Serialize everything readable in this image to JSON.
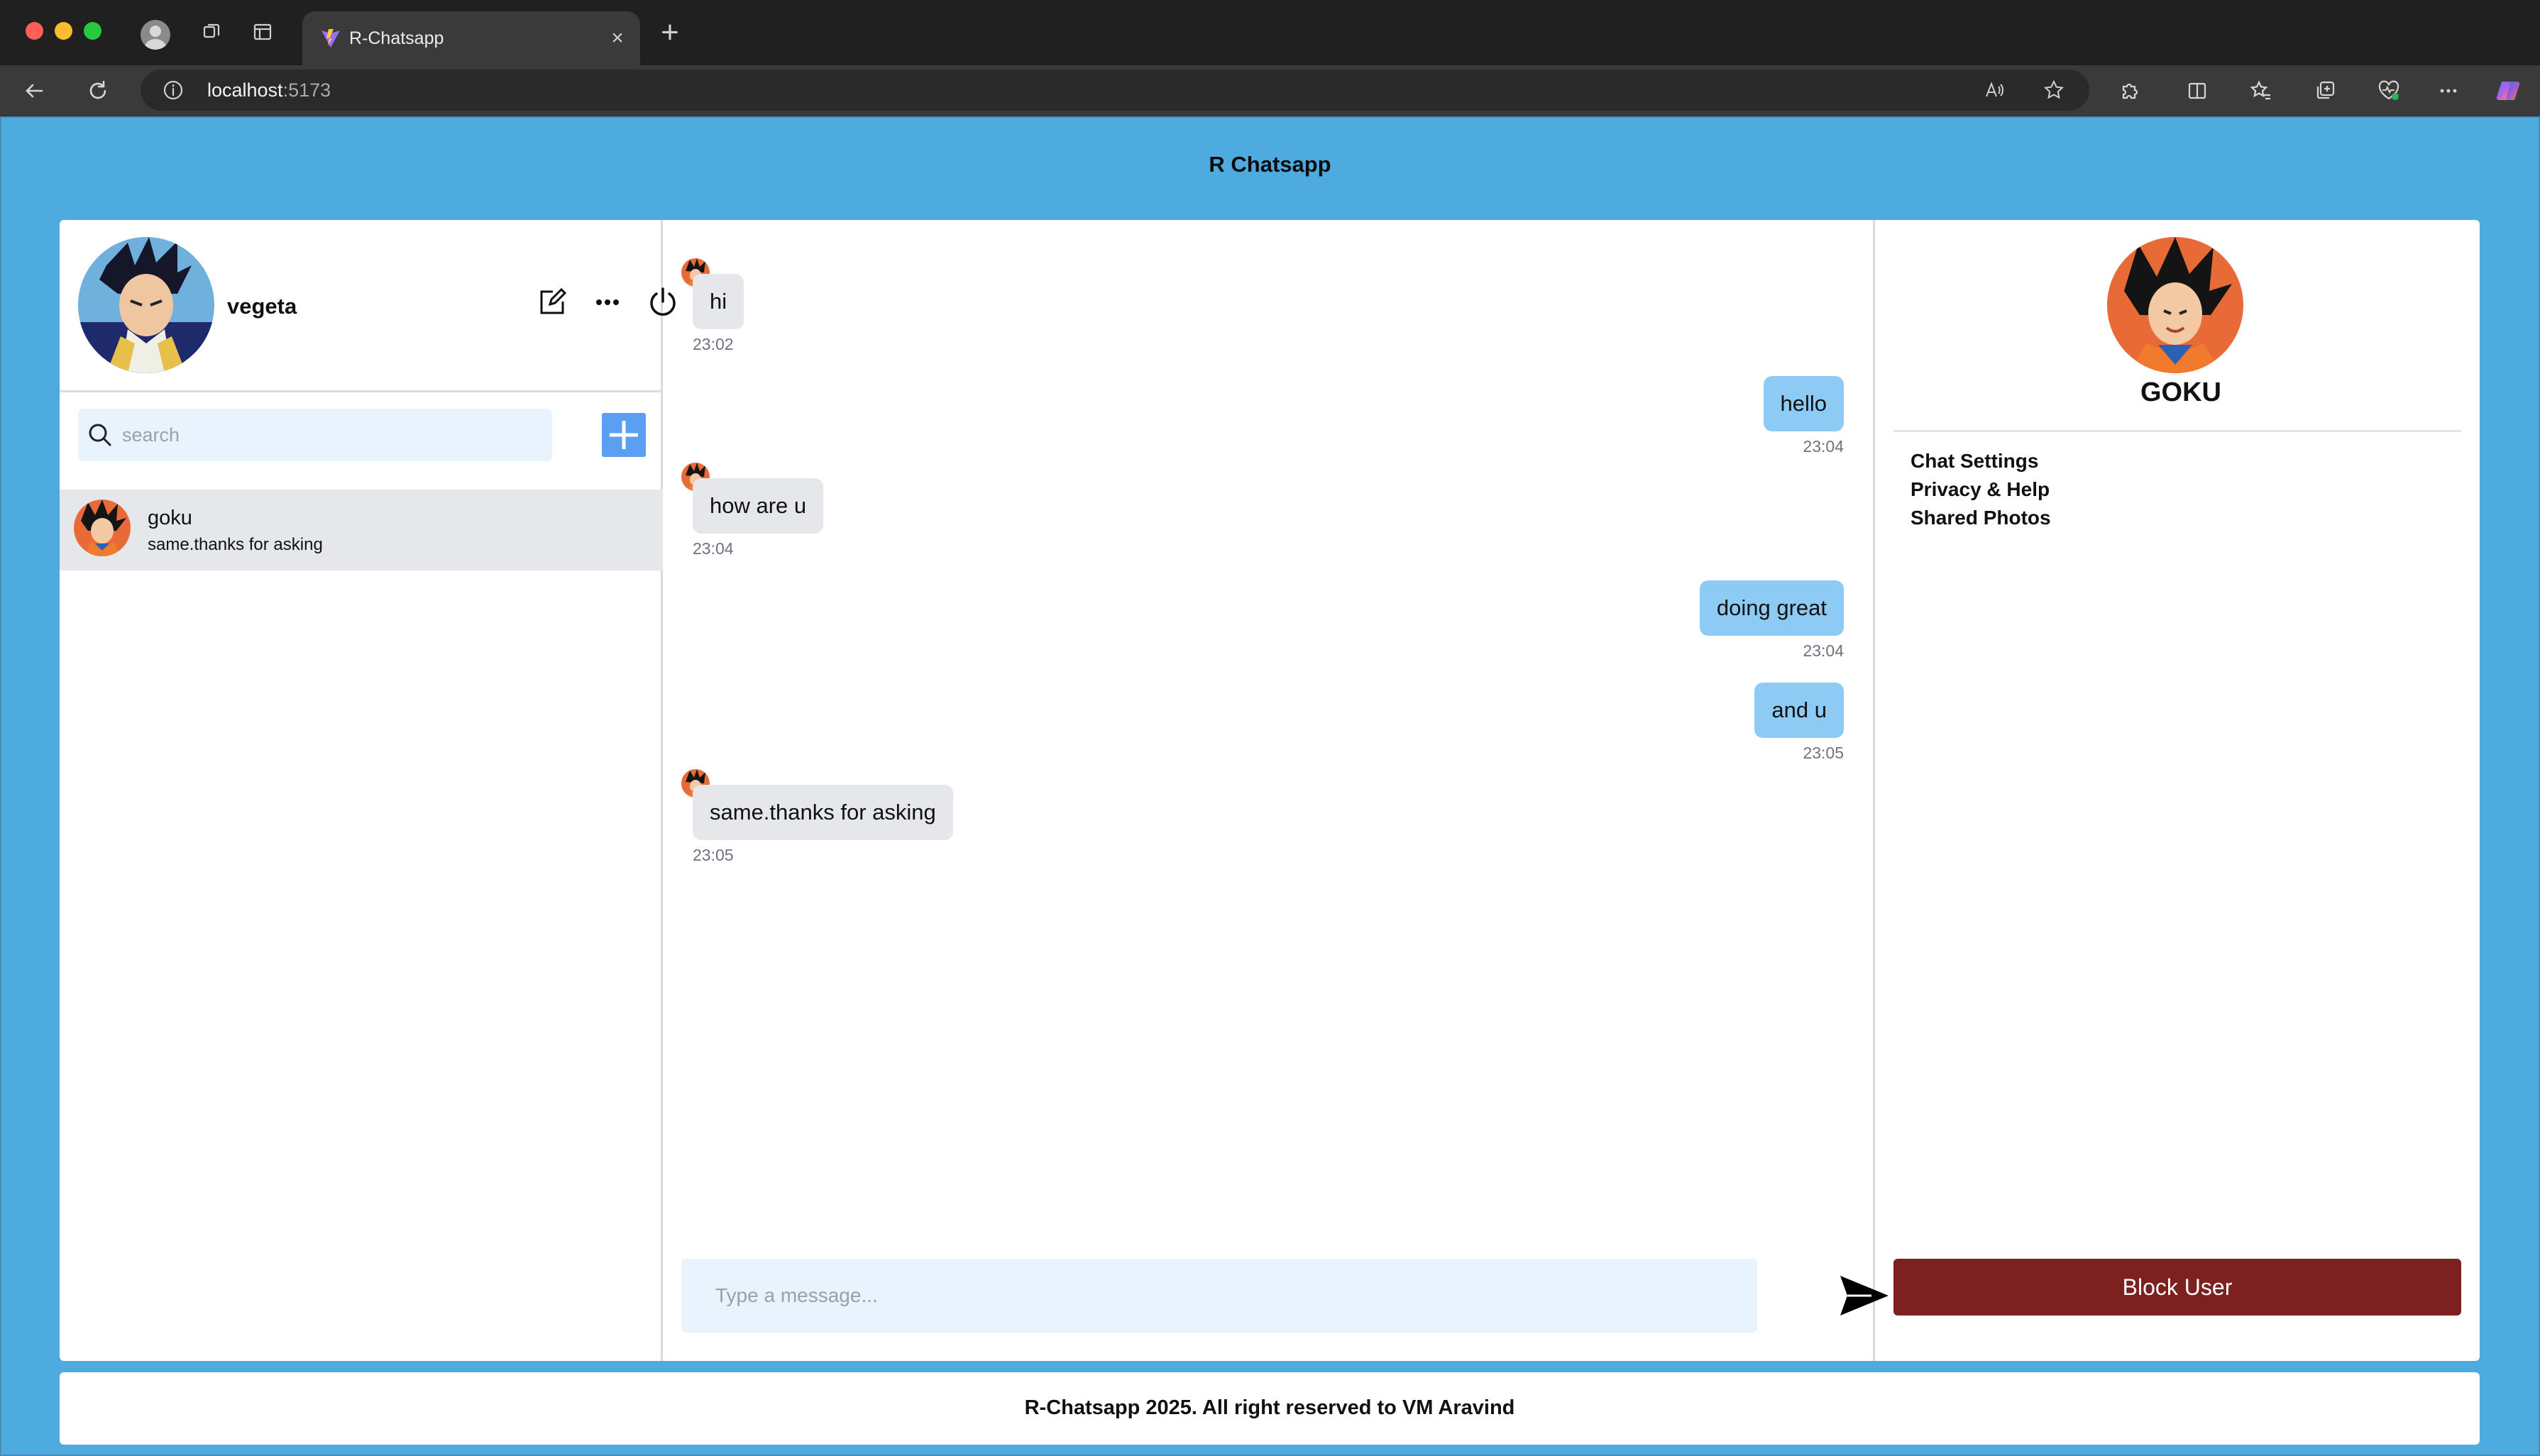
{
  "browser": {
    "tab_title": "R-Chatsapp",
    "tab_close_glyph": "×",
    "new_tab_glyph": "+",
    "url_host": "localhost",
    "url_port": ":5173",
    "icons": [
      "back-icon",
      "reload-icon",
      "info-icon",
      "read-aloud-icon",
      "favorite-icon",
      "extensions-icon",
      "split-screen-icon",
      "favorites-icon",
      "collections-icon",
      "health-icon",
      "more-icon",
      "copilot-icon"
    ]
  },
  "app": {
    "title": "R Chatsapp",
    "footer": "R-Chatsapp 2025. All right reserved to VM Aravind"
  },
  "current_user": {
    "name": "vegeta"
  },
  "search": {
    "placeholder": "search"
  },
  "conversations": [
    {
      "name": "goku",
      "preview": "same.thanks for asking",
      "selected": true
    }
  ],
  "chat": {
    "messages": [
      {
        "direction": "in",
        "text": "hi",
        "time": "23:02"
      },
      {
        "direction": "out",
        "text": "hello",
        "time": "23:04"
      },
      {
        "direction": "in",
        "text": "how are u",
        "time": "23:04"
      },
      {
        "direction": "out",
        "text": "doing great",
        "time": "23:04"
      },
      {
        "direction": "out",
        "text": "and u",
        "time": "23:05"
      },
      {
        "direction": "in",
        "text": "same.thanks for asking",
        "time": "23:05"
      }
    ],
    "composer_placeholder": "Type a message..."
  },
  "peer": {
    "name": "GOKU",
    "options": [
      "Chat Settings",
      "Privacy & Help",
      "Shared Photos"
    ],
    "block_label": "Block User"
  },
  "colors": {
    "page_background": "#4eabe0",
    "outgoing_bubble": "#8dcaf4",
    "incoming_bubble": "#e5e7eb",
    "input_background": "#e8f3fd",
    "add_button": "#5b9ff2",
    "block_button": "#7c2020"
  }
}
